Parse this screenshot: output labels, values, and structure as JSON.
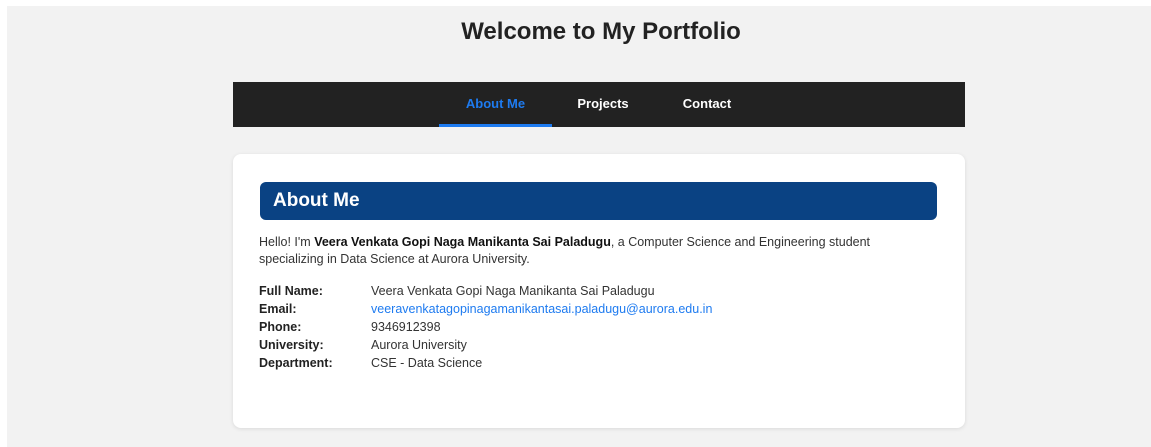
{
  "page": {
    "title": "Welcome to My Portfolio"
  },
  "nav": {
    "items": [
      {
        "label": "About Me",
        "active": true
      },
      {
        "label": "Projects",
        "active": false
      },
      {
        "label": "Contact",
        "active": false
      }
    ]
  },
  "about": {
    "heading": "About Me",
    "intro_prefix": "Hello! I'm ",
    "intro_name": "Veera Venkata Gopi Naga Manikanta Sai Paladugu",
    "intro_suffix": ", a Computer Science and Engineering student specializing in Data Science at Aurora University.",
    "details": [
      {
        "label": "Full Name:",
        "value": "Veera Venkata Gopi Naga Manikanta Sai Paladugu"
      },
      {
        "label": "Email:",
        "value": "veeravenkatagopinagamanikantasai.paladugu@aurora.edu.in"
      },
      {
        "label": "Phone:",
        "value": "9346912398"
      },
      {
        "label": "University:",
        "value": "Aurora University"
      },
      {
        "label": "Department:",
        "value": "CSE - Data Science"
      }
    ]
  },
  "colors": {
    "nav_bg": "#222222",
    "accent": "#1e7bf0",
    "header_bg": "#0a4283",
    "page_bg": "#f2f2f2"
  }
}
